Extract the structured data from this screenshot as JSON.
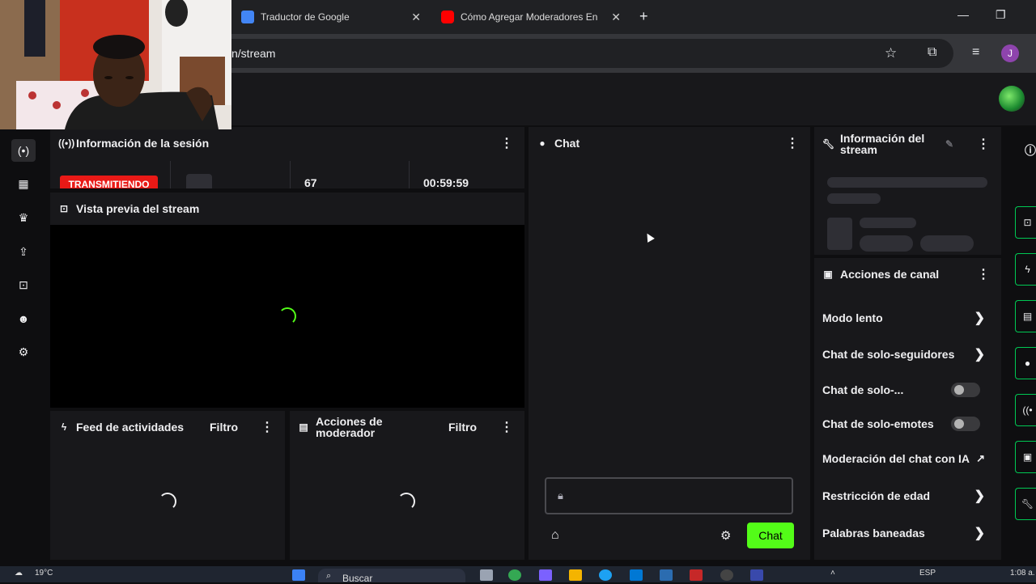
{
  "browser": {
    "tabs": [
      {
        "title": "Traductor de Google",
        "favicon_color": "#4285f4"
      },
      {
        "title": "Cómo Agregar Moderadores En K",
        "favicon_color": "#ff0000"
      }
    ],
    "new_tab_label": "+",
    "url": "n/stream",
    "profile_initial": "J"
  },
  "session": {
    "title": "Información de la sesión",
    "status": "TRANSMITIENDO",
    "viewers": "67",
    "time": "00:59:59"
  },
  "preview": {
    "title": "Vista previa del stream"
  },
  "chat": {
    "title": "Chat",
    "send_label": "Chat"
  },
  "activity": {
    "title": "Feed de actividades",
    "filter": "Filtro"
  },
  "mod_actions": {
    "title": "Acciones de moderador",
    "filter": "Filtro"
  },
  "stream_info": {
    "title": "Información del stream"
  },
  "channel_actions": {
    "title": "Acciones de canal",
    "items": [
      {
        "label": "Modo lento",
        "control": "chevron"
      },
      {
        "label": "Chat de solo-seguidores",
        "control": "chevron"
      },
      {
        "label": "Chat de solo-...",
        "control": "toggle"
      },
      {
        "label": "Chat de solo-emotes",
        "control": "toggle"
      },
      {
        "label": "Moderación del chat con IA",
        "control": "external"
      },
      {
        "label": "Restricción de edad",
        "control": "chevron"
      },
      {
        "label": "Palabras baneadas",
        "control": "chevron"
      }
    ]
  },
  "taskbar": {
    "weather": "19°C",
    "search": "Buscar",
    "lang": "ESP",
    "clock": "1:08 a."
  },
  "colors": {
    "accent": "#53fc18",
    "live": "#e91916",
    "panel": "#18181b",
    "bg": "#0e0e10"
  }
}
